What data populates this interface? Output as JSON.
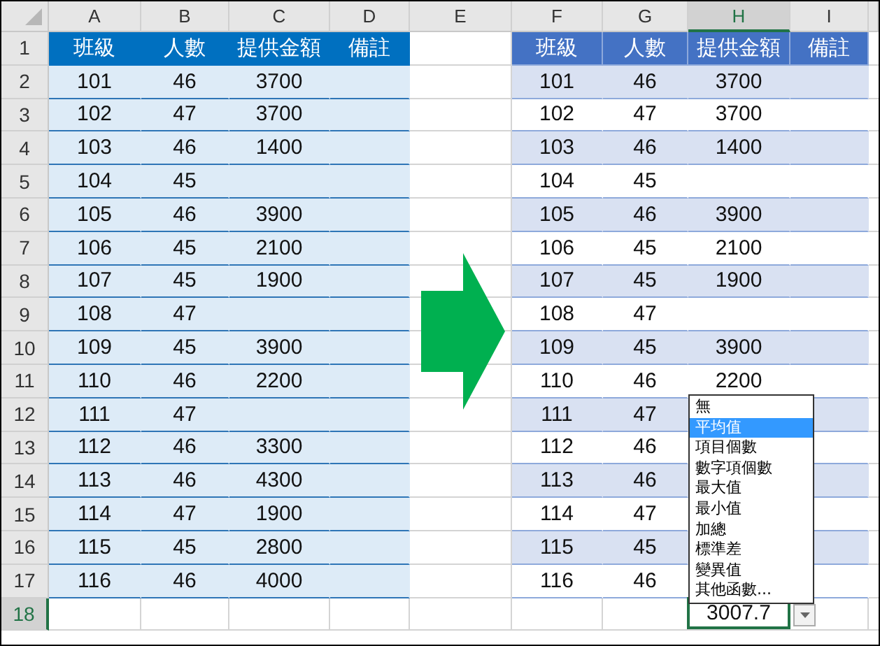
{
  "column_headers": [
    {
      "label": "A",
      "selected": false
    },
    {
      "label": "B",
      "selected": false
    },
    {
      "label": "C",
      "selected": false
    },
    {
      "label": "D",
      "selected": false
    },
    {
      "label": "E",
      "selected": false
    },
    {
      "label": "F",
      "selected": false
    },
    {
      "label": "G",
      "selected": false
    },
    {
      "label": "H",
      "selected": true
    },
    {
      "label": "I",
      "selected": false
    }
  ],
  "row_headers": [
    {
      "label": "1",
      "selected": false
    },
    {
      "label": "2",
      "selected": false
    },
    {
      "label": "3",
      "selected": false
    },
    {
      "label": "4",
      "selected": false
    },
    {
      "label": "5",
      "selected": false
    },
    {
      "label": "6",
      "selected": false
    },
    {
      "label": "7",
      "selected": false
    },
    {
      "label": "8",
      "selected": false
    },
    {
      "label": "9",
      "selected": false
    },
    {
      "label": "10",
      "selected": false
    },
    {
      "label": "11",
      "selected": false
    },
    {
      "label": "12",
      "selected": false
    },
    {
      "label": "13",
      "selected": false
    },
    {
      "label": "14",
      "selected": false
    },
    {
      "label": "15",
      "selected": false
    },
    {
      "label": "16",
      "selected": false
    },
    {
      "label": "17",
      "selected": false
    },
    {
      "label": "18",
      "selected": true
    }
  ],
  "left_table": {
    "headers": [
      "班級",
      "人數",
      "提供金額",
      "備註"
    ],
    "rows": [
      [
        "101",
        "46",
        "3700"
      ],
      [
        "102",
        "47",
        "3700"
      ],
      [
        "103",
        "46",
        "1400"
      ],
      [
        "104",
        "45"
      ],
      [
        "105",
        "46",
        "3900"
      ],
      [
        "106",
        "45",
        "2100"
      ],
      [
        "107",
        "45",
        "1900"
      ],
      [
        "108",
        "47"
      ],
      [
        "109",
        "45",
        "3900"
      ],
      [
        "110",
        "46",
        "2200"
      ],
      [
        "111",
        "47"
      ],
      [
        "112",
        "46",
        "3300"
      ],
      [
        "113",
        "46",
        "4300"
      ],
      [
        "114",
        "47",
        "1900"
      ],
      [
        "115",
        "45",
        "2800"
      ],
      [
        "116",
        "46",
        "4000"
      ]
    ]
  },
  "right_table": {
    "headers": [
      "班級",
      "人數",
      "提供金額",
      "備註"
    ],
    "rows": [
      [
        "101",
        "46",
        "3700"
      ],
      [
        "102",
        "47",
        "3700"
      ],
      [
        "103",
        "46",
        "1400"
      ],
      [
        "104",
        "45"
      ],
      [
        "105",
        "46",
        "3900"
      ],
      [
        "106",
        "45",
        "2100"
      ],
      [
        "107",
        "45",
        "1900"
      ],
      [
        "108",
        "47"
      ],
      [
        "109",
        "45",
        "3900"
      ],
      [
        "110",
        "46",
        "2200"
      ],
      [
        "111",
        "47"
      ],
      [
        "112",
        "46"
      ],
      [
        "113",
        "46"
      ],
      [
        "114",
        "47"
      ],
      [
        "115",
        "45"
      ],
      [
        "116",
        "46"
      ]
    ]
  },
  "total_cell": {
    "value": "3007.7"
  },
  "function_menu": {
    "items": [
      {
        "label": "無",
        "selected": false
      },
      {
        "label": "平均值",
        "selected": true
      },
      {
        "label": "項目個數",
        "selected": false
      },
      {
        "label": "數字項個數",
        "selected": false
      },
      {
        "label": "最大值",
        "selected": false
      },
      {
        "label": "最小值",
        "selected": false
      },
      {
        "label": "加總",
        "selected": false
      },
      {
        "label": "標準差",
        "selected": false
      },
      {
        "label": "變異值",
        "selected": false
      },
      {
        "label": "其他函數...",
        "selected": false
      }
    ]
  }
}
